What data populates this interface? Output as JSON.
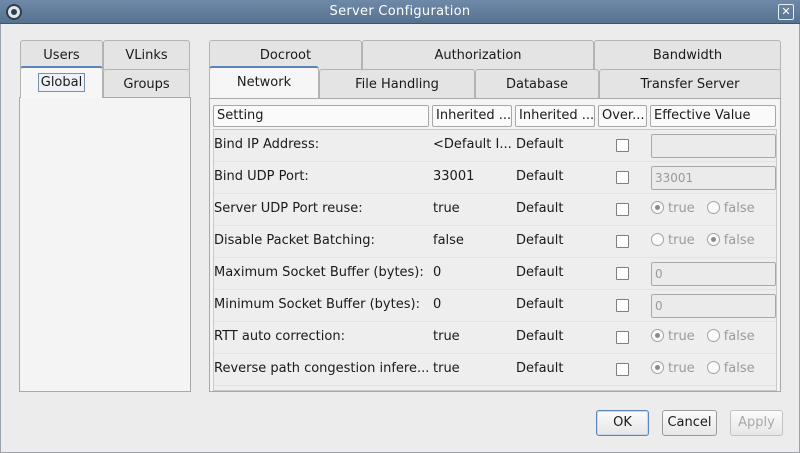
{
  "window": {
    "title": "Server Configuration",
    "close_glyph": "✕"
  },
  "left_tabs": {
    "users": "Users",
    "vlinks": "VLinks",
    "global": "Global",
    "groups": "Groups"
  },
  "right_tabs": {
    "docroot": "Docroot",
    "authorization": "Authorization",
    "bandwidth": "Bandwidth",
    "network": "Network",
    "file_handling": "File Handling",
    "database": "Database",
    "transfer_server": "Transfer Server"
  },
  "table": {
    "headers": [
      "Setting",
      "Inherited ...",
      "Inherited ...",
      "Over...",
      "Effective Value"
    ],
    "rows": [
      {
        "setting": "Bind IP Address:",
        "inherited1": "<Default I...",
        "inherited2": "Default",
        "override": false,
        "type": "text",
        "value": ""
      },
      {
        "setting": "Bind UDP Port:",
        "inherited1": "33001",
        "inherited2": "Default",
        "override": false,
        "type": "text",
        "value": "33001"
      },
      {
        "setting": "Server UDP Port reuse:",
        "inherited1": "true",
        "inherited2": "Default",
        "override": false,
        "type": "radio",
        "value": "true"
      },
      {
        "setting": "Disable Packet Batching:",
        "inherited1": "false",
        "inherited2": "Default",
        "override": false,
        "type": "radio",
        "value": "false"
      },
      {
        "setting": "Maximum Socket Buffer (bytes):",
        "inherited1": "0",
        "inherited2": "Default",
        "override": false,
        "type": "text",
        "value": "0"
      },
      {
        "setting": "Minimum Socket Buffer (bytes):",
        "inherited1": "0",
        "inherited2": "Default",
        "override": false,
        "type": "text",
        "value": "0"
      },
      {
        "setting": "RTT auto correction:",
        "inherited1": "true",
        "inherited2": "Default",
        "override": false,
        "type": "radio",
        "value": "true"
      },
      {
        "setting": "Reverse path congestion infere...",
        "inherited1": "true",
        "inherited2": "Default",
        "override": false,
        "type": "radio",
        "value": "true"
      }
    ],
    "radio_labels": {
      "true": "true",
      "false": "false"
    }
  },
  "buttons": {
    "ok": "OK",
    "cancel": "Cancel",
    "apply": "Apply"
  },
  "colors": {
    "titlebar": "#5f7b99",
    "active_tab_accent": "#5b84b8"
  }
}
